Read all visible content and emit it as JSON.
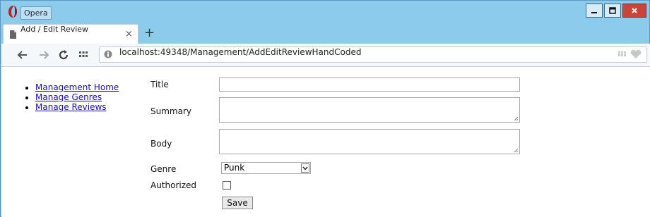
{
  "window": {
    "app_name": "Opera",
    "buttons": {
      "minimize": "–",
      "maximize": "□",
      "close": "x"
    }
  },
  "tab": {
    "title": "Add / Edit Review",
    "close": "×",
    "new_tab": "+"
  },
  "toolbar": {
    "url": "localhost:49348/Management/AddEditReviewHandCoded"
  },
  "sidebar": {
    "links": [
      "Management Home",
      "Manage Genres",
      "Manage Reviews"
    ]
  },
  "form": {
    "title_label": "Title",
    "title_value": "",
    "summary_label": "Summary",
    "summary_value": "",
    "body_label": "Body",
    "body_value": "",
    "genre_label": "Genre",
    "genre_selected": "Punk",
    "authorized_label": "Authorized",
    "authorized_checked": false,
    "save_label": "Save"
  },
  "colors": {
    "title_bar": "#8ccbeb",
    "close_button": "#c9453a",
    "link": "#1a0dab",
    "opera_red": "#cc1b1b"
  }
}
